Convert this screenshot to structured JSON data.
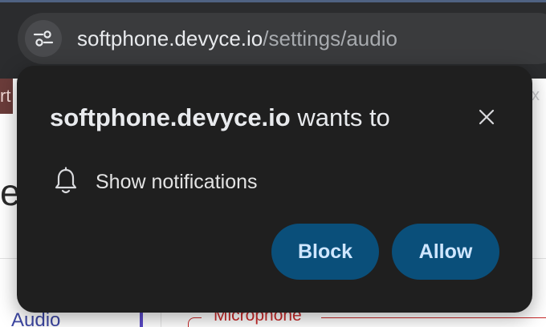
{
  "browser": {
    "url_host": "softphone.devyce.io",
    "url_path": "/settings/audio",
    "site_info_icon": "tune-sliders-icon",
    "background_tab_fragment": "rt",
    "background_close_glyph": "x"
  },
  "page": {
    "heading_fragment": "et",
    "sidebar_item_audio": "Audio",
    "microphone_legend": "Microphone"
  },
  "prompt": {
    "origin": "softphone.devyce.io",
    "title_suffix": " wants to",
    "close_icon": "close-icon",
    "permission_icon": "bell-icon",
    "permission_label": "Show notifications",
    "block_label": "Block",
    "allow_label": "Allow"
  },
  "colors": {
    "prompt_bg": "#1f1f1f",
    "button_bg": "#0a4f7a",
    "button_text": "#cfe6ff",
    "toolbar_bg": "#2b2c2e",
    "omnibox_bg": "#3a3b3d",
    "accent_red": "#c62828",
    "link_indigo": "#3d47a3"
  }
}
